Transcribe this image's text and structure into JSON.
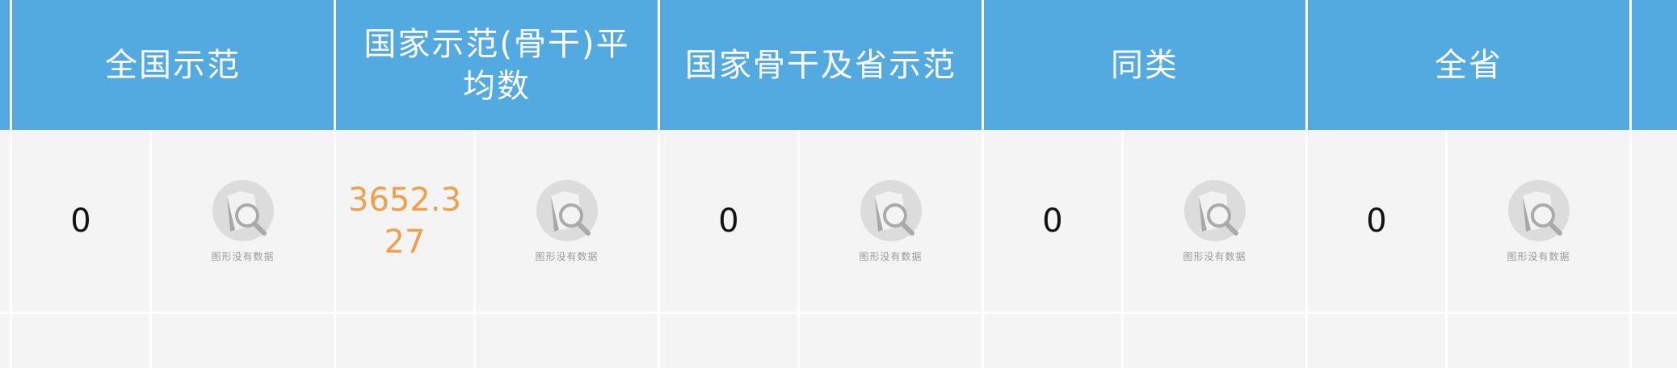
{
  "header": {
    "columns": [
      "全国示范",
      "国家示范(骨干)平均数",
      "国家骨干及省示范",
      "同类",
      "全省"
    ]
  },
  "rows": [
    {
      "values": [
        "0",
        "3652.327",
        "0",
        "0",
        "0"
      ],
      "chart_placeholder_text": "图形没有数据"
    }
  ],
  "colors": {
    "header_bg": "#52aae1",
    "body_bg": "#f4f4f4",
    "highlight_value": "#f0a04a"
  }
}
